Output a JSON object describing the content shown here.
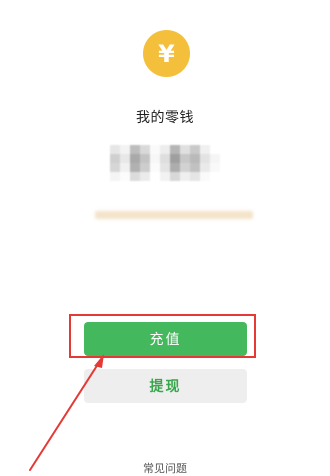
{
  "wallet": {
    "icon": "yuan-coin-icon",
    "icon_symbol": "¥",
    "title": "我的零钱"
  },
  "actions": {
    "recharge_label": "充值",
    "withdraw_label": "提现"
  },
  "footer": {
    "faq_label": "常见问题"
  },
  "colors": {
    "coin": "#f4bf3b",
    "primary_green": "#44b85c",
    "secondary_bg": "#eeeeee",
    "secondary_text": "#3aa64d",
    "annotation_red": "#e53935",
    "blur_note": "#f1dcbc"
  }
}
